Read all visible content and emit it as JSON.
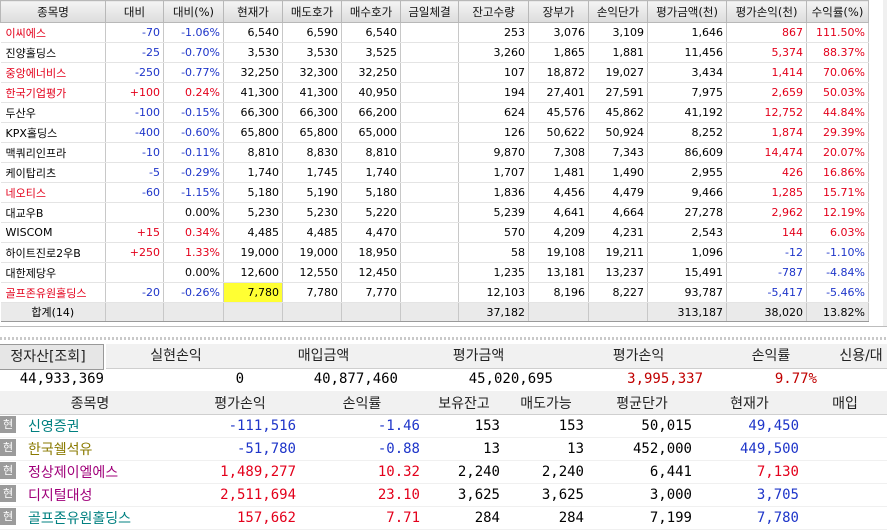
{
  "top_table": {
    "headers": [
      "종목명",
      "대비",
      "대비(%)",
      "현재가",
      "매도호가",
      "매수호가",
      "금일체결",
      "잔고수량",
      "장부가",
      "손익단가",
      "평가금액(천)",
      "평가손익(천)",
      "수익률(%)"
    ],
    "rows": [
      {
        "name": "이씨에스",
        "name_color": "red",
        "diff": "-70",
        "diff_color": "blue",
        "pct": "-1.06%",
        "pct_color": "blue",
        "price": "6,540",
        "ask": "6,590",
        "bid": "6,540",
        "today": "",
        "qty": "253",
        "book": "3,076",
        "bep": "3,109",
        "eval": "1,646",
        "pl": "867",
        "pl_color": "red",
        "ret": "111.50%",
        "ret_color": "red",
        "hl": false
      },
      {
        "name": "진양홀딩스",
        "name_color": "",
        "diff": "-25",
        "diff_color": "blue",
        "pct": "-0.70%",
        "pct_color": "blue",
        "price": "3,530",
        "ask": "3,530",
        "bid": "3,525",
        "today": "",
        "qty": "3,260",
        "book": "1,865",
        "bep": "1,881",
        "eval": "11,456",
        "pl": "5,374",
        "pl_color": "red",
        "ret": "88.37%",
        "ret_color": "red",
        "hl": false
      },
      {
        "name": "중앙에너비스",
        "name_color": "red",
        "diff": "-250",
        "diff_color": "blue",
        "pct": "-0.77%",
        "pct_color": "blue",
        "price": "32,250",
        "ask": "32,300",
        "bid": "32,250",
        "today": "",
        "qty": "107",
        "book": "18,872",
        "bep": "19,027",
        "eval": "3,434",
        "pl": "1,414",
        "pl_color": "red",
        "ret": "70.06%",
        "ret_color": "red",
        "hl": false
      },
      {
        "name": "한국기업평가",
        "name_color": "red",
        "diff": "+100",
        "diff_color": "red",
        "pct": "0.24%",
        "pct_color": "red",
        "price": "41,300",
        "ask": "41,300",
        "bid": "40,950",
        "today": "",
        "qty": "194",
        "book": "27,401",
        "bep": "27,591",
        "eval": "7,975",
        "pl": "2,659",
        "pl_color": "red",
        "ret": "50.03%",
        "ret_color": "red",
        "hl": false
      },
      {
        "name": "두산우",
        "name_color": "",
        "diff": "-100",
        "diff_color": "blue",
        "pct": "-0.15%",
        "pct_color": "blue",
        "price": "66,300",
        "ask": "66,300",
        "bid": "66,200",
        "today": "",
        "qty": "624",
        "book": "45,576",
        "bep": "45,862",
        "eval": "41,192",
        "pl": "12,752",
        "pl_color": "red",
        "ret": "44.84%",
        "ret_color": "red",
        "hl": false
      },
      {
        "name": "KPX홀딩스",
        "name_color": "",
        "diff": "-400",
        "diff_color": "blue",
        "pct": "-0.60%",
        "pct_color": "blue",
        "price": "65,800",
        "ask": "65,800",
        "bid": "65,000",
        "today": "",
        "qty": "126",
        "book": "50,622",
        "bep": "50,924",
        "eval": "8,252",
        "pl": "1,874",
        "pl_color": "red",
        "ret": "29.39%",
        "ret_color": "red",
        "hl": false
      },
      {
        "name": "맥쿼리인프라",
        "name_color": "",
        "diff": "-10",
        "diff_color": "blue",
        "pct": "-0.11%",
        "pct_color": "blue",
        "price": "8,810",
        "ask": "8,830",
        "bid": "8,810",
        "today": "",
        "qty": "9,870",
        "book": "7,308",
        "bep": "7,343",
        "eval": "86,609",
        "pl": "14,474",
        "pl_color": "red",
        "ret": "20.07%",
        "ret_color": "red",
        "hl": false
      },
      {
        "name": "케이탑리츠",
        "name_color": "",
        "diff": "-5",
        "diff_color": "blue",
        "pct": "-0.29%",
        "pct_color": "blue",
        "price": "1,740",
        "ask": "1,745",
        "bid": "1,740",
        "today": "",
        "qty": "1,707",
        "book": "1,481",
        "bep": "1,490",
        "eval": "2,955",
        "pl": "426",
        "pl_color": "red",
        "ret": "16.86%",
        "ret_color": "red",
        "hl": false
      },
      {
        "name": "네오티스",
        "name_color": "red",
        "diff": "-60",
        "diff_color": "blue",
        "pct": "-1.15%",
        "pct_color": "blue",
        "price": "5,180",
        "ask": "5,190",
        "bid": "5,180",
        "today": "",
        "qty": "1,836",
        "book": "4,456",
        "bep": "4,479",
        "eval": "9,466",
        "pl": "1,285",
        "pl_color": "red",
        "ret": "15.71%",
        "ret_color": "red",
        "hl": false
      },
      {
        "name": "대교우B",
        "name_color": "",
        "diff": "",
        "diff_color": "",
        "pct": "0.00%",
        "pct_color": "",
        "price": "5,230",
        "ask": "5,230",
        "bid": "5,220",
        "today": "",
        "qty": "5,239",
        "book": "4,641",
        "bep": "4,664",
        "eval": "27,278",
        "pl": "2,962",
        "pl_color": "red",
        "ret": "12.19%",
        "ret_color": "red",
        "hl": false
      },
      {
        "name": "WISCOM",
        "name_color": "",
        "diff": "+15",
        "diff_color": "red",
        "pct": "0.34%",
        "pct_color": "red",
        "price": "4,485",
        "ask": "4,485",
        "bid": "4,470",
        "today": "",
        "qty": "570",
        "book": "4,209",
        "bep": "4,231",
        "eval": "2,543",
        "pl": "144",
        "pl_color": "red",
        "ret": "6.03%",
        "ret_color": "red",
        "hl": false
      },
      {
        "name": "하이트진로2우B",
        "name_color": "",
        "diff": "+250",
        "diff_color": "red",
        "pct": "1.33%",
        "pct_color": "red",
        "price": "19,000",
        "ask": "19,000",
        "bid": "18,950",
        "today": "",
        "qty": "58",
        "book": "19,108",
        "bep": "19,211",
        "eval": "1,096",
        "pl": "-12",
        "pl_color": "blue",
        "ret": "-1.10%",
        "ret_color": "blue",
        "hl": false
      },
      {
        "name": "대한제당우",
        "name_color": "",
        "diff": "",
        "diff_color": "",
        "pct": "0.00%",
        "pct_color": "",
        "price": "12,600",
        "ask": "12,550",
        "bid": "12,450",
        "today": "",
        "qty": "1,235",
        "book": "13,181",
        "bep": "13,237",
        "eval": "15,491",
        "pl": "-787",
        "pl_color": "blue",
        "ret": "-4.84%",
        "ret_color": "blue",
        "hl": false
      },
      {
        "name": "골프존유원홀딩스",
        "name_color": "red",
        "diff": "-20",
        "diff_color": "blue",
        "pct": "-0.26%",
        "pct_color": "blue",
        "price": "7,780",
        "ask": "7,780",
        "bid": "7,770",
        "today": "",
        "qty": "12,103",
        "book": "8,196",
        "bep": "8,227",
        "eval": "93,787",
        "pl": "-5,417",
        "pl_color": "blue",
        "ret": "-5.46%",
        "ret_color": "blue",
        "hl": true
      }
    ],
    "total": {
      "label": "합계(14)",
      "qty": "37,182",
      "eval": "313,187",
      "pl": "38,020",
      "ret": "13.82%"
    }
  },
  "summary": {
    "headers": [
      "정자산[조회]",
      "실현손익",
      "매입금액",
      "평가금액",
      "평가손익",
      "손익률",
      "신용/대"
    ],
    "values": [
      "44,933,369",
      "0",
      "40,877,460",
      "45,020,695",
      "3,995,337",
      "9.77%",
      ""
    ]
  },
  "bottom_table": {
    "headers": [
      "종목명",
      "평가손익",
      "손익률",
      "보유잔고",
      "매도가능",
      "평균단가",
      "현재가",
      "매입"
    ],
    "tag": "현",
    "rows": [
      {
        "name": "신영증권",
        "name_color": "teal",
        "pl": "-111,516",
        "pl_color": "blue",
        "rate": "-1.46",
        "rate_color": "blue",
        "hold": "153",
        "sell": "153",
        "avg": "50,015",
        "price": "49,450",
        "price_color": "blue"
      },
      {
        "name": "한국쉘석유",
        "name_color": "olive",
        "pl": "-51,780",
        "pl_color": "blue",
        "rate": "-0.88",
        "rate_color": "blue",
        "hold": "13",
        "sell": "13",
        "avg": "452,000",
        "price": "449,500",
        "price_color": "blue"
      },
      {
        "name": "정상제이엘에스",
        "name_color": "purple",
        "pl": "1,489,277",
        "pl_color": "red",
        "rate": "10.32",
        "rate_color": "red",
        "hold": "2,240",
        "sell": "2,240",
        "avg": "6,441",
        "price": "7,130",
        "price_color": "red"
      },
      {
        "name": "디지털대성",
        "name_color": "purple",
        "pl": "2,511,694",
        "pl_color": "red",
        "rate": "23.10",
        "rate_color": "red",
        "hold": "3,625",
        "sell": "3,625",
        "avg": "3,000",
        "price": "3,705",
        "price_color": "blue"
      },
      {
        "name": "골프존유원홀딩스",
        "name_color": "teal",
        "pl": "157,662",
        "pl_color": "red",
        "rate": "7.71",
        "rate_color": "red",
        "hold": "284",
        "sell": "284",
        "avg": "7,199",
        "price": "7,780",
        "price_color": "blue"
      }
    ]
  }
}
